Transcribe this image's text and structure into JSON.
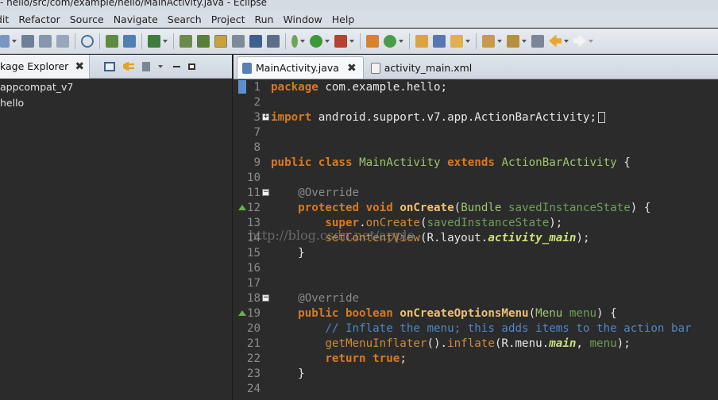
{
  "window": {
    "title": "- hello/src/com/example/hello/MainActivity.java - Eclipse"
  },
  "menubar": {
    "items": [
      "dit",
      "Refactor",
      "Source",
      "Navigate",
      "Search",
      "Project",
      "Run",
      "Window",
      "Help"
    ]
  },
  "explorer": {
    "tab_label": "kage Explorer",
    "close": "✖",
    "items": [
      "appcompat_v7",
      "hello"
    ]
  },
  "editor": {
    "tabs": [
      {
        "label": "MainActivity.java",
        "close": "✖",
        "active": true
      },
      {
        "label": "activity_main.xml",
        "active": false
      }
    ],
    "watermark": "http://blog.csdn.net/apple",
    "lines": [
      {
        "n": "1",
        "tokens": [
          {
            "t": "package",
            "c": "kw"
          },
          {
            "t": " com.example.hello;"
          }
        ]
      },
      {
        "n": "2",
        "tokens": []
      },
      {
        "n": "3",
        "fold": "+",
        "tokens": [
          {
            "t": "import",
            "c": "kw"
          },
          {
            "t": " android.support.v7.app.ActionBarActivity;"
          }
        ],
        "cursor": true
      },
      {
        "n": "7",
        "tokens": []
      },
      {
        "n": "8",
        "tokens": []
      },
      {
        "n": "9",
        "tokens": [
          {
            "t": "public",
            "c": "kw"
          },
          {
            "t": " "
          },
          {
            "t": "class",
            "c": "kw"
          },
          {
            "t": " "
          },
          {
            "t": "MainActivity",
            "c": "cls"
          },
          {
            "t": " "
          },
          {
            "t": "extends",
            "c": "kw"
          },
          {
            "t": " "
          },
          {
            "t": "ActionBarActivity",
            "c": "cls"
          },
          {
            "t": " {"
          }
        ]
      },
      {
        "n": "10",
        "tokens": []
      },
      {
        "n": "11",
        "fold": "−",
        "tokens": [
          {
            "t": "    "
          },
          {
            "t": "@Override",
            "c": "ann"
          }
        ]
      },
      {
        "n": "12",
        "override": true,
        "tokens": [
          {
            "t": "    "
          },
          {
            "t": "protected",
            "c": "kw"
          },
          {
            "t": " "
          },
          {
            "t": "void",
            "c": "kw"
          },
          {
            "t": " "
          },
          {
            "t": "onCreate",
            "c": "fn"
          },
          {
            "t": "("
          },
          {
            "t": "Bundle",
            "c": "cls"
          },
          {
            "t": " "
          },
          {
            "t": "savedInstanceState",
            "c": "param"
          },
          {
            "t": ") {"
          }
        ]
      },
      {
        "n": "13",
        "tokens": [
          {
            "t": "        "
          },
          {
            "t": "super",
            "c": "kw"
          },
          {
            "t": "."
          },
          {
            "t": "onCreate",
            "c": "ty"
          },
          {
            "t": "("
          },
          {
            "t": "savedInstanceState",
            "c": "param"
          },
          {
            "t": ");"
          }
        ]
      },
      {
        "n": "14",
        "tokens": [
          {
            "t": "        "
          },
          {
            "t": "setContentView",
            "c": "ty"
          },
          {
            "t": "(R.layout."
          },
          {
            "t": "activity_main",
            "c": "fld"
          },
          {
            "t": ");"
          }
        ]
      },
      {
        "n": "15",
        "tokens": [
          {
            "t": "    }"
          }
        ]
      },
      {
        "n": "16",
        "tokens": []
      },
      {
        "n": "17",
        "tokens": []
      },
      {
        "n": "18",
        "fold": "−",
        "tokens": [
          {
            "t": "    "
          },
          {
            "t": "@Override",
            "c": "ann"
          }
        ]
      },
      {
        "n": "19",
        "override": true,
        "tokens": [
          {
            "t": "    "
          },
          {
            "t": "public",
            "c": "kw"
          },
          {
            "t": " "
          },
          {
            "t": "boolean",
            "c": "kw"
          },
          {
            "t": " "
          },
          {
            "t": "onCreateOptionsMenu",
            "c": "fn"
          },
          {
            "t": "("
          },
          {
            "t": "Menu",
            "c": "cls"
          },
          {
            "t": " "
          },
          {
            "t": "menu",
            "c": "param"
          },
          {
            "t": ") {"
          }
        ]
      },
      {
        "n": "20",
        "tokens": [
          {
            "t": "        "
          },
          {
            "t": "// Inflate the menu; this adds items to the action bar",
            "c": "cm"
          }
        ]
      },
      {
        "n": "21",
        "tokens": [
          {
            "t": "        "
          },
          {
            "t": "getMenuInflater",
            "c": "ty"
          },
          {
            "t": "()."
          },
          {
            "t": "inflate",
            "c": "ty"
          },
          {
            "t": "(R.menu."
          },
          {
            "t": "main",
            "c": "fld"
          },
          {
            "t": ", "
          },
          {
            "t": "menu",
            "c": "param"
          },
          {
            "t": ");"
          }
        ]
      },
      {
        "n": "22",
        "tokens": [
          {
            "t": "        "
          },
          {
            "t": "return",
            "c": "kw"
          },
          {
            "t": " "
          },
          {
            "t": "true",
            "c": "kw"
          },
          {
            "t": ";"
          }
        ]
      },
      {
        "n": "23",
        "tokens": [
          {
            "t": "    }"
          }
        ]
      },
      {
        "n": "24",
        "tokens": []
      }
    ]
  },
  "toolbar": {
    "icons": [
      "new-icon",
      "save-icon",
      "save-all-icon",
      "print-icon",
      "skip-breakpoints-icon",
      "open-type-icon",
      "console-icon",
      "task-icon",
      "java-perspective-icon",
      "highlight-icon",
      "sdk-manager-icon",
      "avd-manager-icon",
      "lint-icon",
      "debug-icon",
      "run-icon",
      "external-tools-icon",
      "new-java-project-icon",
      "new-class-icon",
      "open-folder-icon",
      "search-icon",
      "next-annotation-icon",
      "prev-annotation-icon",
      "back-icon",
      "forward-icon"
    ]
  }
}
